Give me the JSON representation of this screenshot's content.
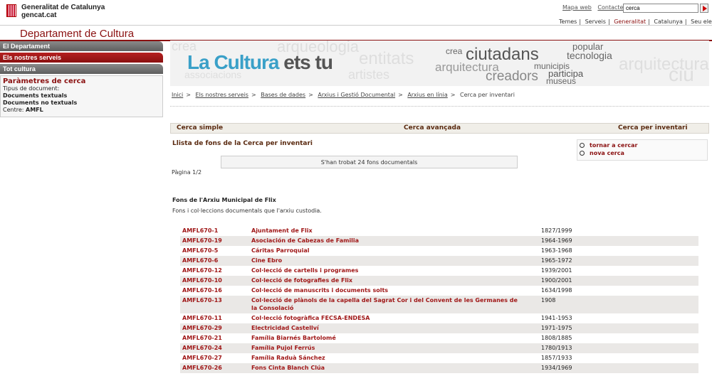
{
  "header": {
    "org_name_line1": "Generalitat de Catalunya",
    "org_name_line2": "gencat.cat",
    "links": [
      "Mapa web",
      "Contacte"
    ],
    "search_value": "cerca",
    "nav": [
      "Temes",
      "Serveis",
      "Generalitat",
      "Catalunya",
      "Seu electrònica"
    ]
  },
  "department": "Departament de Cultura",
  "sidebar": {
    "tabs": [
      "El Departament",
      "Els nostres serveis",
      "Tot cultura"
    ],
    "params_title": "Paràmetres de cerca",
    "doc_type_label": "Tipus de document:",
    "doc_types": [
      "Documents textuals",
      "Documents no textuals"
    ],
    "centre_label": "Centre:",
    "centre_value": "AMFL"
  },
  "banner": {
    "title_part1": "La Cultura",
    "title_part2": "ets tu",
    "words": [
      "crea",
      "ciutadans",
      "popular",
      "tecnologia",
      "arquitectura",
      "municipis",
      "participa",
      "creadors",
      "museus"
    ]
  },
  "breadcrumb": {
    "links": [
      "Inici",
      "Els nostres serveis",
      "Bases de dades",
      "Arxius i Gestió Documental",
      "Arxius en línia"
    ],
    "current": "Cerca per inventari"
  },
  "search_tabs": [
    "Cerca simple",
    "Cerca avançada",
    "Cerca per inventari"
  ],
  "list_title": "Llista de fons de la Cerca per inventari",
  "actions": [
    "tornar a cercar",
    "nova cerca"
  ],
  "found_text": "S'han trobat 24 fons documentals",
  "page_text": "Pàgina 1/2",
  "fons_title": "Fons de l'Arxiu Municipal de Flix",
  "fons_desc": "Fons i col·leccions documentals que l'arxiu custodia.",
  "results": [
    {
      "code": "AMFL670-1",
      "name": "Ajuntament de Flix",
      "dates": "1827/1999"
    },
    {
      "code": "AMFL670-19",
      "name": "Asociación de Cabezas de Familia",
      "dates": "1964-1969"
    },
    {
      "code": "AMFL670-5",
      "name": "Cáritas Parroquial",
      "dates": "1963-1968"
    },
    {
      "code": "AMFL670-6",
      "name": "Cine Ebro",
      "dates": "1965-1972"
    },
    {
      "code": "AMFL670-12",
      "name": "Col·lecció de cartells i programes",
      "dates": "1939/2001"
    },
    {
      "code": "AMFL670-10",
      "name": "Col·lecció de fotografies de Flix",
      "dates": "1900/2001"
    },
    {
      "code": "AMFL670-16",
      "name": "Col·lecció de manuscrits i documents solts",
      "dates": "1634/1998"
    },
    {
      "code": "AMFL670-13",
      "name": "Col·lecció de plànols de la capella del Sagrat Cor i del Convent de les Germanes de la Consolació",
      "dates": "1908"
    },
    {
      "code": "AMFL670-11",
      "name": "Col·lecció fotogràfica FECSA-ENDESA",
      "dates": "1941-1953"
    },
    {
      "code": "AMFL670-29",
      "name": "Electricidad Castellví",
      "dates": "1971-1975"
    },
    {
      "code": "AMFL670-21",
      "name": "Família Biarnés Bartolomé",
      "dates": "1808/1885"
    },
    {
      "code": "AMFL670-24",
      "name": "Família Pujol Ferrús",
      "dates": "1780/1913"
    },
    {
      "code": "AMFL670-27",
      "name": "Família Raduà Sánchez",
      "dates": "1857/1933"
    },
    {
      "code": "AMFL670-26",
      "name": "Fons Cinta Blanch Clúa",
      "dates": "1934/1969"
    }
  ]
}
